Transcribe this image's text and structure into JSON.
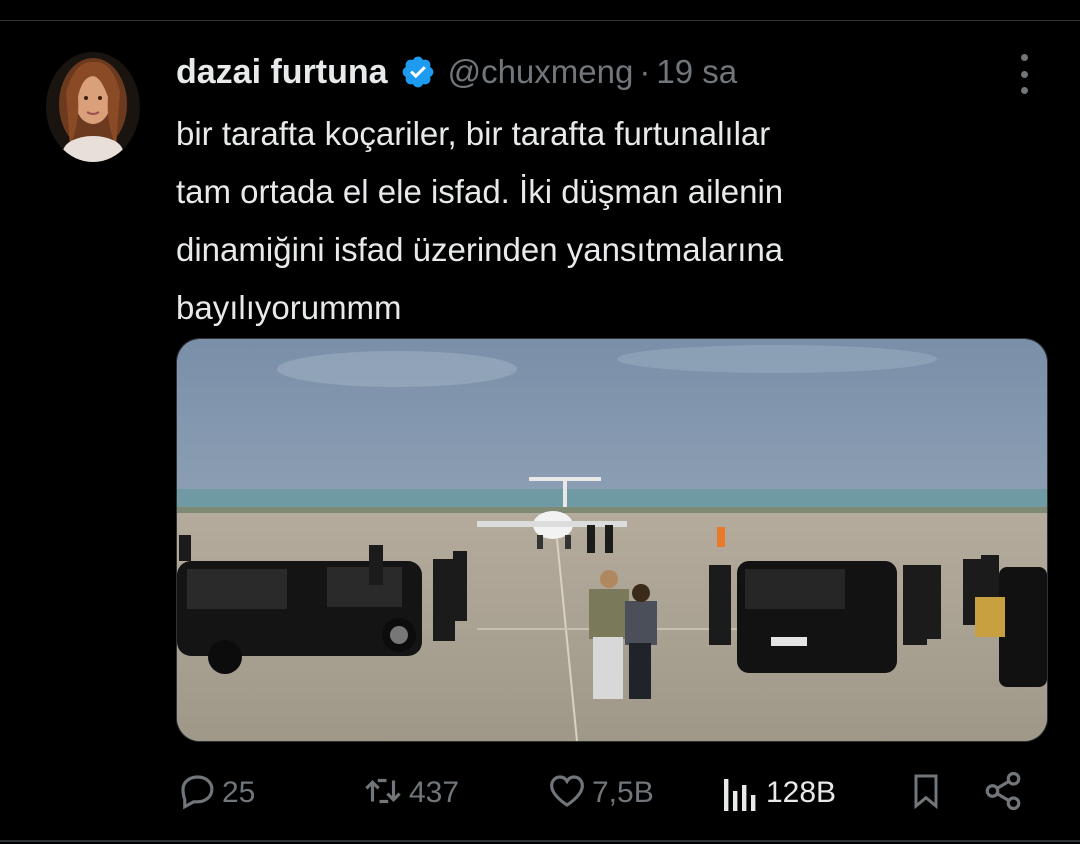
{
  "tweet": {
    "display_name": "dazai furtuna",
    "handle": "@chuxmeng",
    "separator": "·",
    "time": "19 sa",
    "verified": true,
    "text_lines": [
      "bir tarafta koçariler, bir tarafta furtunalılar",
      "tam ortada el ele isfad. İki düşman ailenin",
      "dinamiğini isfad üzerinden yansıtmalarına",
      "bayılıyorummm"
    ]
  },
  "actions": {
    "replies": "25",
    "retweets": "437",
    "likes": "7,5B",
    "views": "128B"
  },
  "icons": {
    "verified": "verified-badge-icon",
    "more": "more-options-icon",
    "reply": "reply-icon",
    "retweet": "retweet-icon",
    "like": "heart-icon",
    "views": "views-icon",
    "bookmark": "bookmark-icon",
    "share": "share-icon"
  },
  "colors": {
    "background": "#000000",
    "text": "#e7e9ea",
    "muted": "#71767b",
    "verified": "#1d9bf0",
    "divider": "#2f3336"
  }
}
